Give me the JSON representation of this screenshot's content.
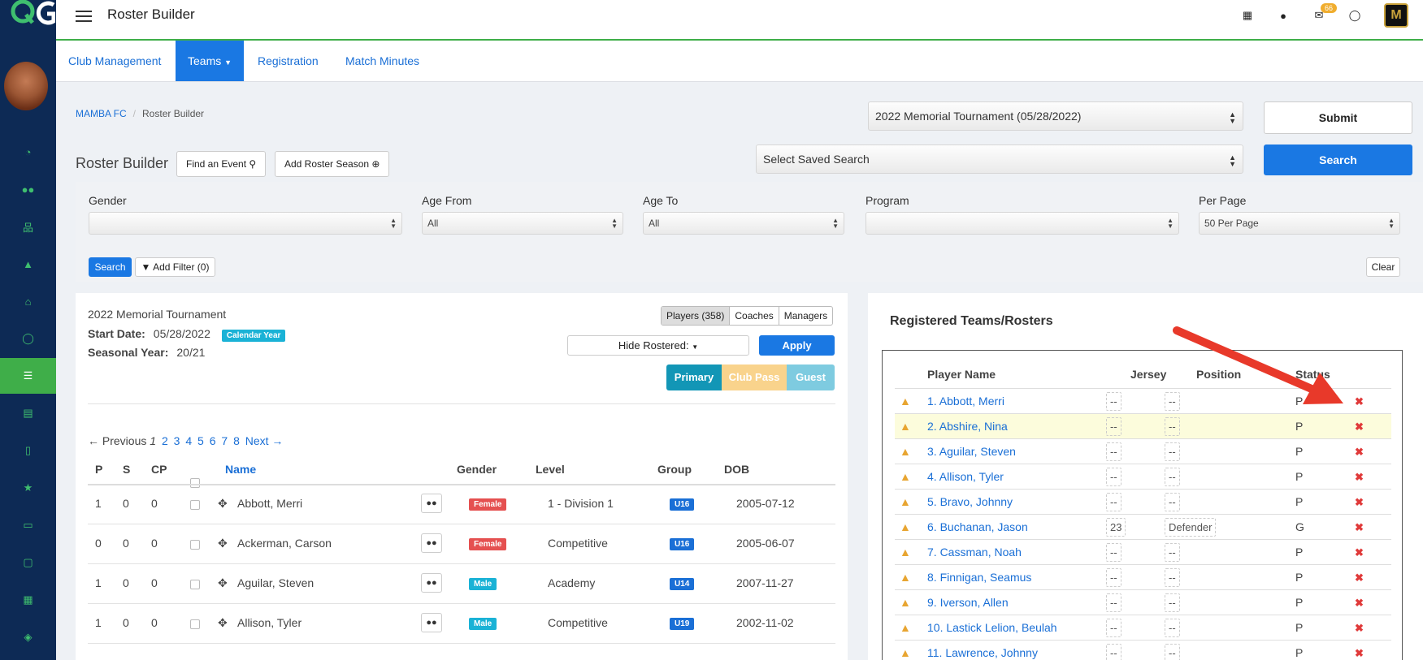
{
  "app": {
    "title": "Roster Builder"
  },
  "topbar": {
    "mail_count": "66"
  },
  "subnav": {
    "tabs": [
      "Club Management",
      "Teams",
      "Registration",
      "Match Minutes"
    ]
  },
  "breadcrumb": {
    "club": "MAMBA FC",
    "current": "Roster Builder"
  },
  "event_select": {
    "value": "2022 Memorial Tournament (05/28/2022)"
  },
  "submit_label": "Submit",
  "saved_search": {
    "value": "Select Saved Search"
  },
  "search_label": "Search",
  "roster_builder": {
    "title": "Roster Builder",
    "find_event": "Find an Event",
    "add_season": "Add Roster Season"
  },
  "filters": {
    "gender": {
      "label": "Gender",
      "value": ""
    },
    "age_from": {
      "label": "Age From",
      "value": "All"
    },
    "age_to": {
      "label": "Age To",
      "value": "All"
    },
    "program": {
      "label": "Program",
      "value": ""
    },
    "per_page": {
      "label": "Per Page",
      "value": "50 Per Page"
    },
    "search_btn": "Search",
    "add_filter": "Add Filter (0)",
    "clear": "Clear"
  },
  "event": {
    "title": "2022 Memorial Tournament",
    "start_label": "Start Date:",
    "start_date": "05/28/2022",
    "calendar_tag": "Calendar Year",
    "seasonal_label": "Seasonal Year:",
    "seasonal_year": "20/21",
    "seg": [
      "Players (358)",
      "Coaches",
      "Managers"
    ],
    "hide_rostered": "Hide Rostered:",
    "apply": "Apply",
    "type_tabs": [
      "Primary",
      "Club Pass",
      "Guest"
    ]
  },
  "pager": {
    "prev": "← Previous",
    "current": "1",
    "pages": [
      "2",
      "3",
      "4",
      "5",
      "6",
      "7",
      "8"
    ],
    "next": "Next →"
  },
  "players_table": {
    "headers": {
      "p": "P",
      "s": "S",
      "cp": "CP",
      "name": "Name",
      "gender": "Gender",
      "level": "Level",
      "group": "Group",
      "dob": "DOB"
    },
    "rows": [
      {
        "p": "1",
        "s": "0",
        "cp": "0",
        "name": "Abbott, Merri",
        "gender": "Female",
        "level": "1 - Division 1",
        "group": "U16",
        "dob": "2005-07-12"
      },
      {
        "p": "0",
        "s": "0",
        "cp": "0",
        "name": "Ackerman, Carson",
        "gender": "Female",
        "level": "Competitive",
        "group": "U16",
        "dob": "2005-06-07"
      },
      {
        "p": "1",
        "s": "0",
        "cp": "0",
        "name": "Aguilar, Steven",
        "gender": "Male",
        "level": "Academy",
        "group": "U14",
        "dob": "2007-11-27"
      },
      {
        "p": "1",
        "s": "0",
        "cp": "0",
        "name": "Allison, Tyler",
        "gender": "Male",
        "level": "Competitive",
        "group": "U19",
        "dob": "2002-11-02"
      }
    ]
  },
  "registered": {
    "title": "Registered Teams/Rosters",
    "headers": {
      "name": "Player Name",
      "jersey": "Jersey",
      "position": "Position",
      "status": "Status"
    },
    "rows": [
      {
        "name": "1. Abbott, Merri",
        "jersey": "--",
        "position": "--",
        "status": "P"
      },
      {
        "name": "2. Abshire, Nina",
        "jersey": "--",
        "position": "--",
        "status": "P"
      },
      {
        "name": "3. Aguilar, Steven",
        "jersey": "--",
        "position": "--",
        "status": "P"
      },
      {
        "name": "4. Allison, Tyler",
        "jersey": "--",
        "position": "--",
        "status": "P"
      },
      {
        "name": "5. Bravo, Johnny",
        "jersey": "--",
        "position": "--",
        "status": "P"
      },
      {
        "name": "6. Buchanan, Jason",
        "jersey": "23",
        "position": "Defender",
        "status": "G"
      },
      {
        "name": "7. Cassman, Noah",
        "jersey": "--",
        "position": "--",
        "status": "P"
      },
      {
        "name": "8. Finnigan, Seamus",
        "jersey": "--",
        "position": "--",
        "status": "P"
      },
      {
        "name": "9. Iverson, Allen",
        "jersey": "--",
        "position": "--",
        "status": "P"
      },
      {
        "name": "10. Lastick Lelion, Beulah",
        "jersey": "--",
        "position": "--",
        "status": "P"
      },
      {
        "name": "11. Lawrence, Johnny",
        "jersey": "--",
        "position": "--",
        "status": "P"
      }
    ]
  },
  "colors": {
    "nav": "#0d2a55",
    "accent": "#3fae49",
    "primary": "#1a78e3",
    "remove": "#e03a3a",
    "arrow": "#e8392a"
  }
}
